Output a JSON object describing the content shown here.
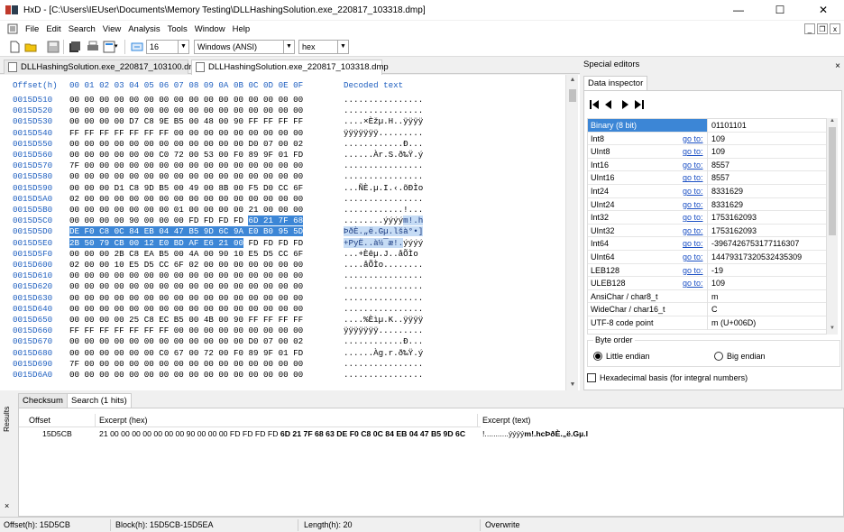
{
  "window": {
    "title": "HxD - [C:\\Users\\IEUser\\Documents\\Memory Testing\\DLLHashingSolution.exe_220817_103318.dmp]",
    "controls": {
      "minimize": "—",
      "maximize": "☐",
      "close": "✕"
    }
  },
  "menu": {
    "items": [
      "File",
      "Edit",
      "Search",
      "View",
      "Analysis",
      "Tools",
      "Window",
      "Help"
    ],
    "mdi": {
      "minimize": "_",
      "restore": "❐",
      "close": "x"
    }
  },
  "toolbar": {
    "bytes_per_row": "16",
    "charset": "Windows (ANSI)",
    "offset_base": "hex"
  },
  "doc_tabs": [
    {
      "label": "DLLHashingSolution.exe_220817_103100.dmp",
      "active": false
    },
    {
      "label": "DLLHashingSolution.exe_220817_103318.dmp",
      "active": true
    }
  ],
  "hex": {
    "offset_header": "Offset(h)",
    "column_header": "00 01 02 03 04 05 06 07 08 09 0A 0B 0C 0D 0E 0F",
    "text_header": "Decoded text",
    "rows": [
      {
        "offset": "0015D510",
        "bytes": "00 00 00 00 00 00 00 00 00 00 00 00 00 00 00 00",
        "text": "................"
      },
      {
        "offset": "0015D520",
        "bytes": "00 00 00 00 00 00 00 00 00 00 00 00 00 00 00 00",
        "text": "................"
      },
      {
        "offset": "0015D530",
        "bytes": "00 00 00 00 D7 C8 9E B5 00 48 00 90 FF FF FF FF",
        "text": "....×Èžµ.H..ÿÿÿÿ"
      },
      {
        "offset": "0015D540",
        "bytes": "FF FF FF FF FF FF FF 00 00 00 00 00 00 00 00 00",
        "text": "ÿÿÿÿÿÿÿ........."
      },
      {
        "offset": "0015D550",
        "bytes": "00 00 00 00 00 00 00 00 00 00 00 00 D0 07 00 02 00",
        "text": "............Ð..."
      },
      {
        "offset": "0015D560",
        "bytes": "00 00 00 00 00 00 C0 72 00 53 00 F0 89 9F 01 FD",
        "text": "......Àr.S.ð‰Ÿ.ý"
      },
      {
        "offset": "0015D570",
        "bytes": "7F 00 00 00 00 00 00 00 00 00 00 00 00 00 00 00",
        "text": "................"
      },
      {
        "offset": "0015D580",
        "bytes": "00 00 00 00 00 00 00 00 00 00 00 00 00 00 00 00",
        "text": "................"
      },
      {
        "offset": "0015D590",
        "bytes": "00 00 00 D1 C8 9D B5 00 49 00 8B 00 F5 D0 CC 6F",
        "text": "...ÑÈ.µ.I.‹.õÐÌo"
      },
      {
        "offset": "0015D5A0",
        "bytes": "02 00 00 00 00 00 00 00 00 00 00 00 00 00 00 00",
        "text": "................"
      },
      {
        "offset": "0015D5B0",
        "bytes": "00 00 00 00 00 00 00 01 00 00 00 00 21 00 00 00",
        "text": "............!..."
      },
      {
        "offset": "0015D5C0",
        "bytes": "00 00 00 00 90 00 00 00 FD FD FD FD 6D 21 7F 68 63",
        "text": "........ýýýým!.hc",
        "sel_from": 12
      },
      {
        "offset": "0015D5D0",
        "bytes": "DE F0 C8 0C 84 EB 04 47 B5 9D 6C 9A E0 B0 95 5D",
        "text": "ÞðÈ.„ë.Gµ.lšà°•]",
        "sel_all": true
      },
      {
        "offset": "0015D5E0",
        "bytes": "2B 50 79 CB 00 12 E0 BD AF E6 21 00 FD FD FD FD",
        "text": "+PyË..à½¯æ!.ýýýý",
        "sel_to": 11
      },
      {
        "offset": "0015D5F0",
        "bytes": "00 00 00 2B C8 EA B5 00 4A 00 90 10 E5 D5 CC 6F",
        "text": "...+Èêµ.J..åÕÌo"
      },
      {
        "offset": "0015D600",
        "bytes": "02 00 00 10 E5 D5 CC 6F 02 00 00 00 00 00 00 00",
        "text": "....åÕÌo........"
      },
      {
        "offset": "0015D610",
        "bytes": "00 00 00 00 00 00 00 00 00 00 00 00 00 00 00 00",
        "text": "................"
      },
      {
        "offset": "0015D620",
        "bytes": "00 00 00 00 00 00 00 00 00 00 00 00 00 00 00 00",
        "text": "................"
      },
      {
        "offset": "0015D630",
        "bytes": "00 00 00 00 00 00 00 00 00 00 00 00 00 00 00 00",
        "text": "................"
      },
      {
        "offset": "0015D640",
        "bytes": "00 00 00 00 00 00 00 00 00 00 00 00 00 00 00 00",
        "text": "................"
      },
      {
        "offset": "0015D650",
        "bytes": "00 00 00 00 25 C8 EC B5 00 4B 00 90 FF FF FF FF",
        "text": "....%Èìµ.K..ÿÿÿÿ"
      },
      {
        "offset": "0015D660",
        "bytes": "FF FF FF FF FF FF FF 00 00 00 00 00 00 00 00 00",
        "text": "ÿÿÿÿÿÿÿ........."
      },
      {
        "offset": "0015D670",
        "bytes": "00 00 00 00 00 00 00 00 00 00 00 00 D0 07 00 02 00",
        "text": "............Ð..."
      },
      {
        "offset": "0015D680",
        "bytes": "00 00 00 00 00 00 C0 67 00 72 00 F0 89 9F 01 FD",
        "text": "......Àg.r.ð‰Ÿ.ý"
      },
      {
        "offset": "0015D690",
        "bytes": "7F 00 00 00 00 00 00 00 00 00 00 00 00 00 00 00",
        "text": "................"
      },
      {
        "offset": "0015D6A0",
        "bytes": "00 00 00 00 00 00 00 00 00 00 00 00 00 00 00 00",
        "text": "................"
      }
    ]
  },
  "special_editors": {
    "title": "Special editors",
    "close": "×",
    "tab": "Data inspector",
    "goto_label": "go to:",
    "rows": [
      {
        "name": "Binary (8 bit)",
        "value": "01101101",
        "goto": false,
        "highlight": true
      },
      {
        "name": "Int8",
        "value": "109",
        "goto": true
      },
      {
        "name": "UInt8",
        "value": "109",
        "goto": true
      },
      {
        "name": "Int16",
        "value": "8557",
        "goto": true
      },
      {
        "name": "UInt16",
        "value": "8557",
        "goto": true
      },
      {
        "name": "Int24",
        "value": "8331629",
        "goto": true
      },
      {
        "name": "UInt24",
        "value": "8331629",
        "goto": true
      },
      {
        "name": "Int32",
        "value": "1753162093",
        "goto": true
      },
      {
        "name": "UInt32",
        "value": "1753162093",
        "goto": true
      },
      {
        "name": "Int64",
        "value": "-3967426753177116307",
        "goto": true
      },
      {
        "name": "UInt64",
        "value": "14479317320532435309",
        "goto": true
      },
      {
        "name": "LEB128",
        "value": "-19",
        "goto": true
      },
      {
        "name": "ULEB128",
        "value": "109",
        "goto": true
      },
      {
        "name": "AnsiChar / char8_t",
        "value": "m",
        "goto": false
      },
      {
        "name": "WideChar / char16_t",
        "value": "C",
        "goto": false
      },
      {
        "name": "UTF-8 code point",
        "value": "m (U+006D)",
        "goto": false
      }
    ],
    "byte_order": {
      "legend": "Byte order",
      "little": "Little endian",
      "big": "Big endian",
      "selected": "little"
    },
    "hex_basis": "Hexadecimal basis (for integral numbers)"
  },
  "results": {
    "side_label": "Results",
    "side_close": "×",
    "tabs": [
      {
        "label": "Checksum",
        "active": false
      },
      {
        "label": "Search (1 hits)",
        "active": true
      }
    ],
    "headers": {
      "offset": "Offset",
      "hex": "Excerpt (hex)",
      "text": "Excerpt (text)"
    },
    "row": {
      "offset": "15D5CB",
      "hex_plain": "21 00 00 00 00 00 00 00 90 00 00 00 FD FD FD FD ",
      "hex_bold": "6D 21 7F 68 63 DE F0 C8 0C 84 EB 04 47 B5 9D 6C",
      "text_plain": "!...........ýýýý",
      "text_bold": "m!.hcÞðÈ.„ë.Gµ.l"
    }
  },
  "status": {
    "offset": "Offset(h): 15D5CB",
    "block": "Block(h): 15D5CB-15D5EA",
    "length": "Length(h): 20",
    "mode": "Overwrite"
  }
}
